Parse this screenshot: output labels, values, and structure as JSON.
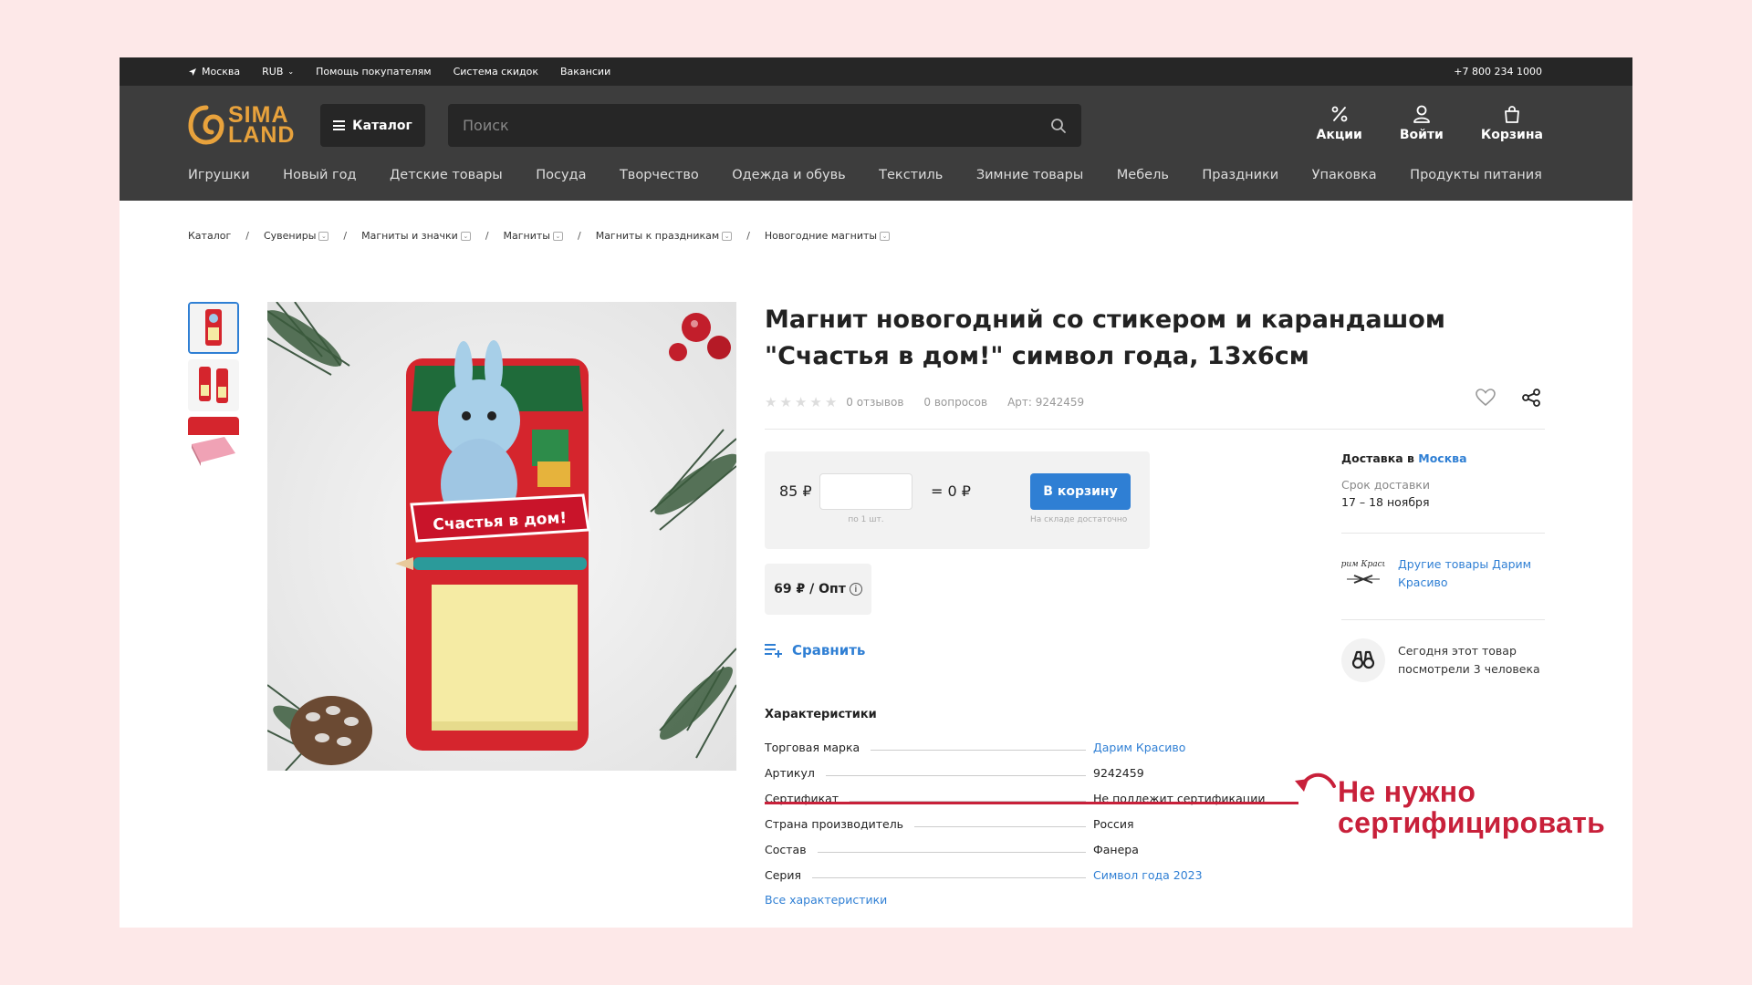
{
  "topbar": {
    "city": "Москва",
    "currency": "RUB",
    "links": [
      "Помощь покупателям",
      "Система скидок",
      "Вакансии"
    ],
    "phone": "+7 800 234 1000"
  },
  "header": {
    "logo_line1": "SIMA",
    "logo_line2": "LAND",
    "catalog_label": "Каталог",
    "search_placeholder": "Поиск",
    "icons": {
      "promo": "Акции",
      "login": "Войти",
      "cart": "Корзина"
    }
  },
  "nav": [
    "Игрушки",
    "Новый год",
    "Детские товары",
    "Посуда",
    "Творчество",
    "Одежда и обувь",
    "Текстиль",
    "Зимние товары",
    "Мебель",
    "Праздники",
    "Упаковка",
    "Продукты питания"
  ],
  "breadcrumb": [
    "Каталог",
    "Сувениры",
    "Магниты и значки",
    "Магниты",
    "Магниты к праздникам",
    "Новогодние магниты"
  ],
  "product": {
    "title": "Магнит новогодний со стикером и карандашом \"Счастья в дом!\" символ года, 13х6см",
    "reviews": "0 отзывов",
    "questions": "0 вопросов",
    "article": "Арт: 9242459",
    "image_banner": "Счастья в дом!",
    "price": "85 ₽",
    "qty_note": "по 1 шт.",
    "total": "= 0 ₽",
    "cart_button": "В корзину",
    "stock": "На складе достаточно",
    "opt_price": "69 ₽ / Опт",
    "compare": "Сравнить"
  },
  "characteristics": {
    "title": "Характеристики",
    "rows": [
      {
        "key": "Торговая марка",
        "value": "Дарим Красиво",
        "link": true
      },
      {
        "key": "Артикул",
        "value": "9242459",
        "link": false
      },
      {
        "key": "Сертификат",
        "value": "Не подлежит сертификации",
        "link": false
      },
      {
        "key": "Страна производитель",
        "value": "Россия",
        "link": false
      },
      {
        "key": "Состав",
        "value": "Фанера",
        "link": false
      },
      {
        "key": "Серия",
        "value": "Символ года 2023",
        "link": true
      }
    ],
    "all_link": "Все характеристики"
  },
  "side": {
    "delivery_prefix": "Доставка в",
    "delivery_city": "Москва",
    "delivery_term_label": "Срок доставки",
    "delivery_dates": "17 – 18 ноября",
    "brand_link": "Другие товары Дарим Красиво",
    "brand_logo_text": "Дарим Красиво",
    "views": "Сегодня этот товар посмотрели 3 человека"
  },
  "annotation": {
    "line1": "Не нужно",
    "line2": "сертифицировать",
    "color": "#c8203a"
  },
  "colors": {
    "accent": "#2f7fd4",
    "header_bg": "#3d3d3d",
    "topbar_bg": "#262626",
    "logo": "#e8a23c"
  }
}
